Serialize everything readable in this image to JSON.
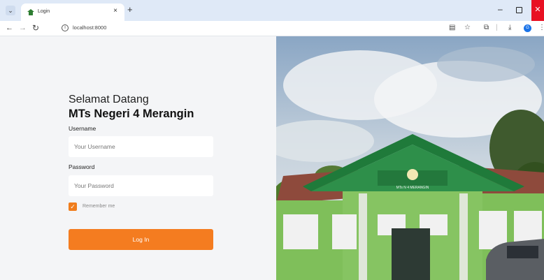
{
  "browser": {
    "tab_title": "Login",
    "tab_close": "×",
    "new_tab": "+",
    "tab_menu": "⌄",
    "url": "localhost:8000",
    "profile_initial": "G",
    "window_close": "✕",
    "window_min": "–"
  },
  "login": {
    "welcome": "Selamat Datang",
    "school_name": "MTs Negeri 4 Merangin",
    "username_label": "Username",
    "username_placeholder": "Your Username",
    "password_label": "Password",
    "password_placeholder": "Your Password",
    "remember_label": "Remember me",
    "remember_checked": true,
    "submit_label": "Log In",
    "accent_color": "#f47c20"
  },
  "photo": {
    "building_sign": "MTs N 4 MERANGIN"
  }
}
